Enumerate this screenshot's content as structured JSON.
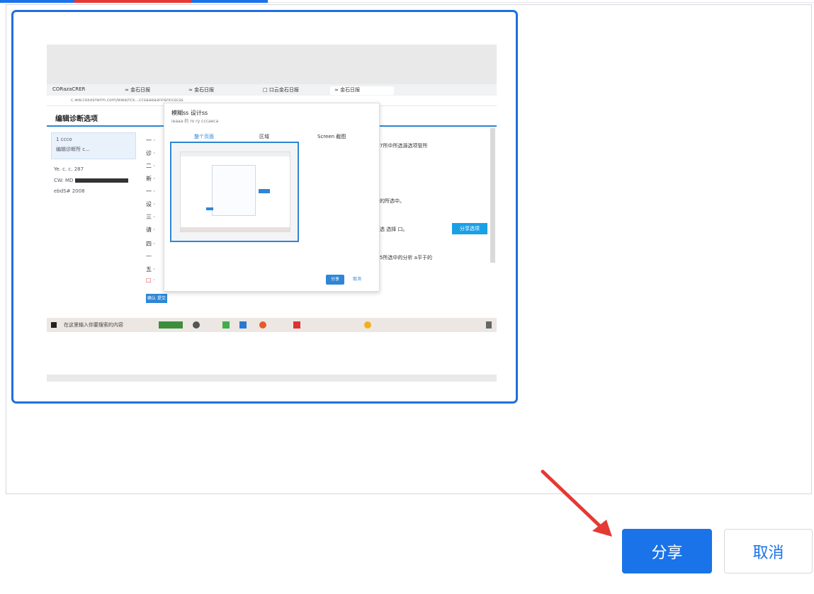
{
  "colors": {
    "primary": "#1a73e8",
    "tab_accent": "#e53935",
    "arrow": "#e53935"
  },
  "actions": {
    "share_label": "分享",
    "cancel_label": "取消"
  },
  "preview": {
    "browser_tabs": [
      "CORazaCRER",
      "≈ 金石日报",
      "≈ 金石日报",
      "□ 口云金石日报",
      "≈ 金石日报"
    ],
    "address_text": "c.ww.coxxsrwrm.com/wwe/rcx...ccsaaeaannsnncscss",
    "page_title": "编辑诊断选项",
    "sidebar": {
      "line1": "1 ccco",
      "line2": "编辑诊断所 c...",
      "line3": "Ye. c. c. 287",
      "line4": "CW: MD",
      "line5": "ebdS#  2008"
    },
    "dialog": {
      "title": "模糊ss 设计ss",
      "subtitle": "ieaaa 的 ro ry cccaeca",
      "tabs": [
        "整个页面",
        "区域",
        "Screen 截图"
      ],
      "ok_label": "分享",
      "cancel_label": "取消"
    },
    "right_texts": [
      "7所中所选源选项管所",
      "的所选中。",
      "选 选择 口。",
      "5所选中的分析 a平于的"
    ],
    "cyan_button_label": "分享选项",
    "small_button_label": "确认 提交",
    "taskbar_text": "在这里输入你要搜索的内容"
  }
}
